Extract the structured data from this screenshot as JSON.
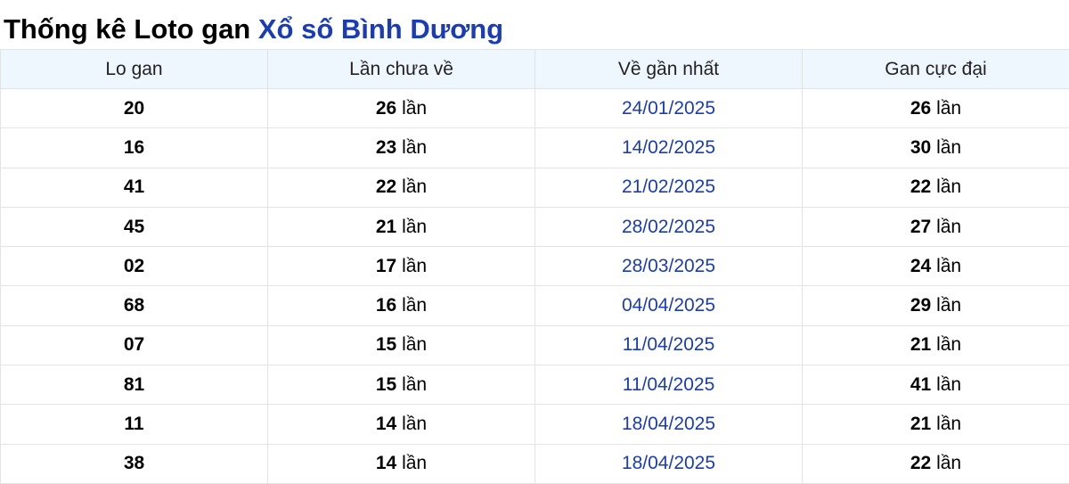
{
  "title": {
    "prefix": "Thống kê Loto gan ",
    "highlight": "Xổ số Bình Dương"
  },
  "table": {
    "headers": [
      "Lo gan",
      "Lần chưa về",
      "Về gần nhất",
      "Gan cực đại"
    ],
    "unit": "lần",
    "rows": [
      {
        "lo": "20",
        "missed": "26",
        "last": "24/01/2025",
        "max": "26"
      },
      {
        "lo": "16",
        "missed": "23",
        "last": "14/02/2025",
        "max": "30"
      },
      {
        "lo": "41",
        "missed": "22",
        "last": "21/02/2025",
        "max": "22"
      },
      {
        "lo": "45",
        "missed": "21",
        "last": "28/02/2025",
        "max": "27"
      },
      {
        "lo": "02",
        "missed": "17",
        "last": "28/03/2025",
        "max": "24"
      },
      {
        "lo": "68",
        "missed": "16",
        "last": "04/04/2025",
        "max": "29"
      },
      {
        "lo": "07",
        "missed": "15",
        "last": "11/04/2025",
        "max": "21"
      },
      {
        "lo": "81",
        "missed": "15",
        "last": "11/04/2025",
        "max": "41"
      },
      {
        "lo": "11",
        "missed": "14",
        "last": "18/04/2025",
        "max": "21"
      },
      {
        "lo": "38",
        "missed": "14",
        "last": "18/04/2025",
        "max": "22"
      }
    ]
  },
  "colors": {
    "accent": "#1a3cb5",
    "header_bg": "#eef6fe",
    "border": "#e3e3e3"
  }
}
